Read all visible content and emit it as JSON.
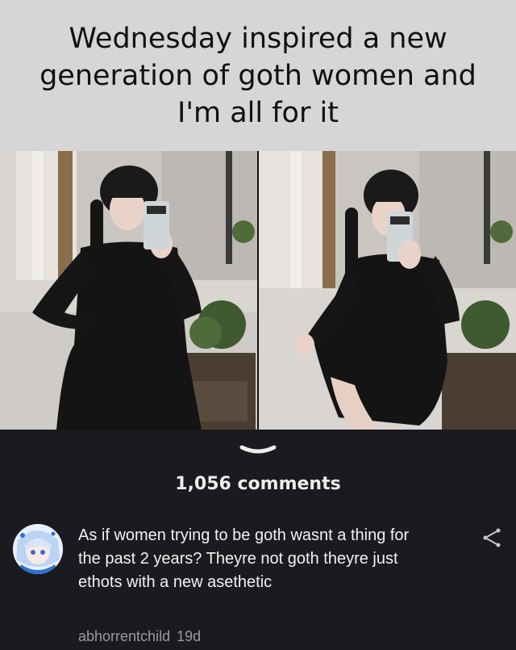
{
  "meme": {
    "caption": "Wednesday inspired a new generation of goth women and I'm all for it"
  },
  "comments_section": {
    "count_label": "1,056 comments",
    "comment": {
      "text": "As if women trying to be goth wasnt a thing for the past 2 years? Theyre not goth theyre just ethots with a new asethetic",
      "username": "abhorrentchild",
      "age": "19d"
    }
  },
  "colors": {
    "caption_bg": "#d6d6d6",
    "page_bg": "#1a1a1f",
    "comment_text": "#f2f2f2",
    "meta_text": "#9a9aa2"
  },
  "icons": {
    "expand": "chevron-down-icon",
    "share": "share-icon",
    "avatar": "anime-avatar"
  }
}
